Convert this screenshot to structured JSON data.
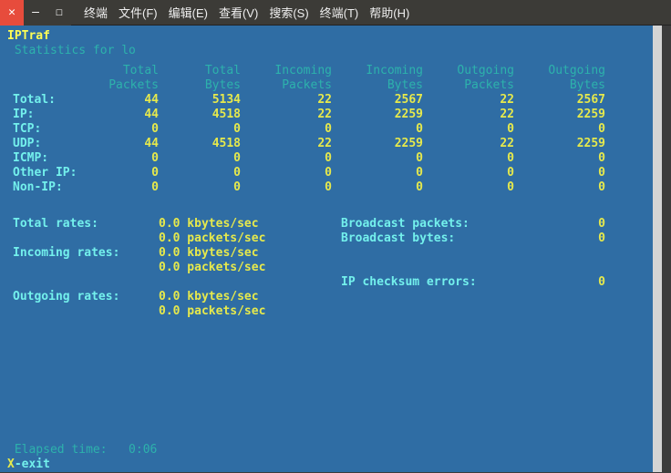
{
  "window": {
    "close_glyph": "✕",
    "min_glyph": "—",
    "max_glyph": "☐"
  },
  "menubar": [
    "终端",
    "文件(F)",
    "编辑(E)",
    "查看(V)",
    "搜索(S)",
    "终端(T)",
    "帮助(H)"
  ],
  "app_title": "IPTraf",
  "section_title": " Statistics for lo ",
  "headers": {
    "total_packets_1": "Total",
    "total_packets_2": "Packets",
    "total_bytes_1": "Total",
    "total_bytes_2": "Bytes",
    "incoming_packets_1": "Incoming",
    "incoming_packets_2": "Packets",
    "incoming_bytes_1": "Incoming",
    "incoming_bytes_2": "Bytes",
    "outgoing_packets_1": "Outgoing",
    "outgoing_packets_2": "Packets",
    "outgoing_bytes_1": "Outgoing",
    "outgoing_bytes_2": "Bytes"
  },
  "rows": [
    {
      "label": "Total:",
      "tp": "44",
      "tb": "5134",
      "ip": "22",
      "ib": "2567",
      "op": "22",
      "ob": "2567"
    },
    {
      "label": "IP:",
      "tp": "44",
      "tb": "4518",
      "ip": "22",
      "ib": "2259",
      "op": "22",
      "ob": "2259"
    },
    {
      "label": "TCP:",
      "tp": "0",
      "tb": "0",
      "ip": "0",
      "ib": "0",
      "op": "0",
      "ob": "0"
    },
    {
      "label": "UDP:",
      "tp": "44",
      "tb": "4518",
      "ip": "22",
      "ib": "2259",
      "op": "22",
      "ob": "2259"
    },
    {
      "label": "ICMP:",
      "tp": "0",
      "tb": "0",
      "ip": "0",
      "ib": "0",
      "op": "0",
      "ob": "0"
    },
    {
      "label": "Other IP:",
      "tp": "0",
      "tb": "0",
      "ip": "0",
      "ib": "0",
      "op": "0",
      "ob": "0"
    },
    {
      "label": "Non-IP:",
      "tp": "0",
      "tb": "0",
      "ip": "0",
      "ib": "0",
      "op": "0",
      "ob": "0"
    }
  ],
  "rates": {
    "total_label": "Total rates:",
    "total_kb": "0.0 kbytes/sec",
    "total_pk": "0.0 packets/sec",
    "incoming_label": "Incoming rates:",
    "incoming_kb": "0.0 kbytes/sec",
    "incoming_pk": "0.0 packets/sec",
    "outgoing_label": "Outgoing rates:",
    "outgoing_kb": "0.0 kbytes/sec",
    "outgoing_pk": "0.0 packets/sec"
  },
  "broadcast": {
    "packets_label": "Broadcast packets:",
    "packets_val": "0",
    "bytes_label": "Broadcast bytes:",
    "bytes_val": "0",
    "checksum_label": "IP checksum errors:",
    "checksum_val": "0"
  },
  "elapsed": " Elapsed time:   0:06 ",
  "exit": {
    "key": "X",
    "label": "-exit"
  }
}
